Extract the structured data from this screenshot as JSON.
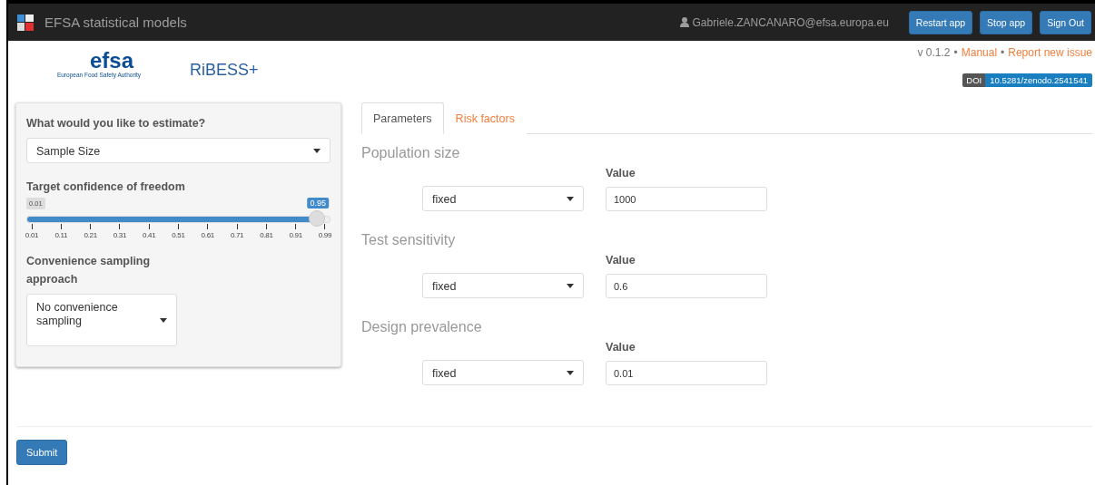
{
  "navbar": {
    "title": "EFSA statistical models",
    "user": "Gabriele.ZANCANARO@efsa.europa.eu",
    "buttons": [
      "Restart app",
      "Stop app",
      "Sign Out"
    ]
  },
  "header": {
    "logo_caption": "European Food Safety Authority",
    "logo_word": "efsa",
    "app_title": "RiBESS+",
    "version": "v 0.1.2",
    "separator": "•",
    "links": [
      "Manual",
      "Report new issue"
    ],
    "doi_label": "DOI",
    "doi": "10.5281/zenodo.2541541"
  },
  "sidebar": {
    "estimate_label": "What would you like to estimate?",
    "estimate_value": "Sample Size",
    "slider": {
      "label": "Target confidence of freedom",
      "min_label": "0.01",
      "value_label": "0.95",
      "level": 0.959,
      "ticks": [
        "0.01",
        "0.11",
        "0.21",
        "0.31",
        "0.41",
        "0.51",
        "0.61",
        "0.71",
        "0.81",
        "0.91",
        "0.99"
      ]
    },
    "convenience_label": "Convenience sampling approach",
    "convenience_value": "No convenience sampling"
  },
  "tabs": [
    {
      "label": "Parameters",
      "selected": true
    },
    {
      "label": "Risk factors",
      "selected": false
    }
  ],
  "parameters": [
    {
      "title": "Population size",
      "mode": "fixed",
      "value_label": "Value",
      "value": "1000"
    },
    {
      "title": "Test sensitivity",
      "mode": "fixed",
      "value_label": "Value",
      "value": "0.6"
    },
    {
      "title": "Design prevalence",
      "mode": "fixed",
      "value_label": "Value",
      "value": "0.01"
    }
  ],
  "submit": "Submit"
}
